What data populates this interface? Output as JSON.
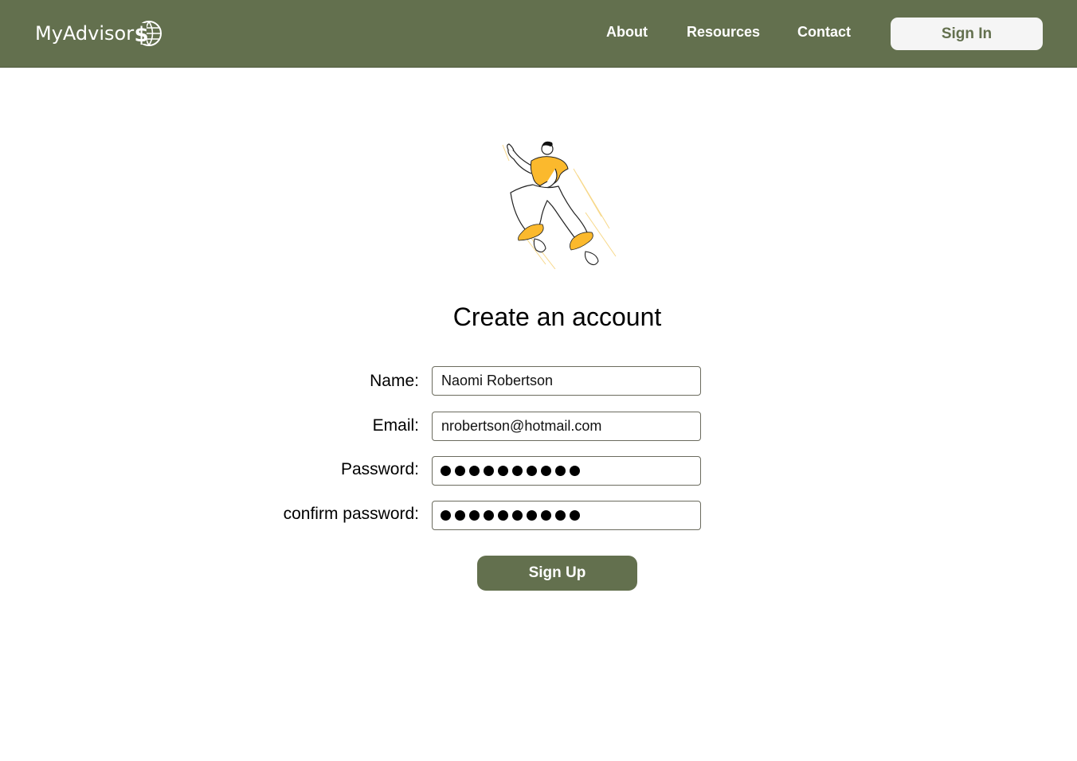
{
  "header": {
    "logo_text": "MyAdvisor",
    "logo_icon": "dollar-globe-icon",
    "nav": [
      {
        "label": "About"
      },
      {
        "label": "Resources"
      },
      {
        "label": "Contact"
      }
    ],
    "signin_label": "Sign In"
  },
  "illustration": {
    "icon": "jumping-person-illustration"
  },
  "form": {
    "title": "Create an account",
    "fields": {
      "name": {
        "label": "Name:",
        "value": "Naomi Robertson"
      },
      "email": {
        "label": "Email:",
        "value": "nrobertson@hotmail.com"
      },
      "password": {
        "label": "Password:",
        "masked_length": 10
      },
      "confirm": {
        "label": "confirm password:",
        "masked_length": 10
      }
    },
    "submit_label": "Sign Up"
  },
  "colors": {
    "brand": "#63704e",
    "accent": "#fbb92d",
    "signin_bg": "#f5f5f5"
  }
}
